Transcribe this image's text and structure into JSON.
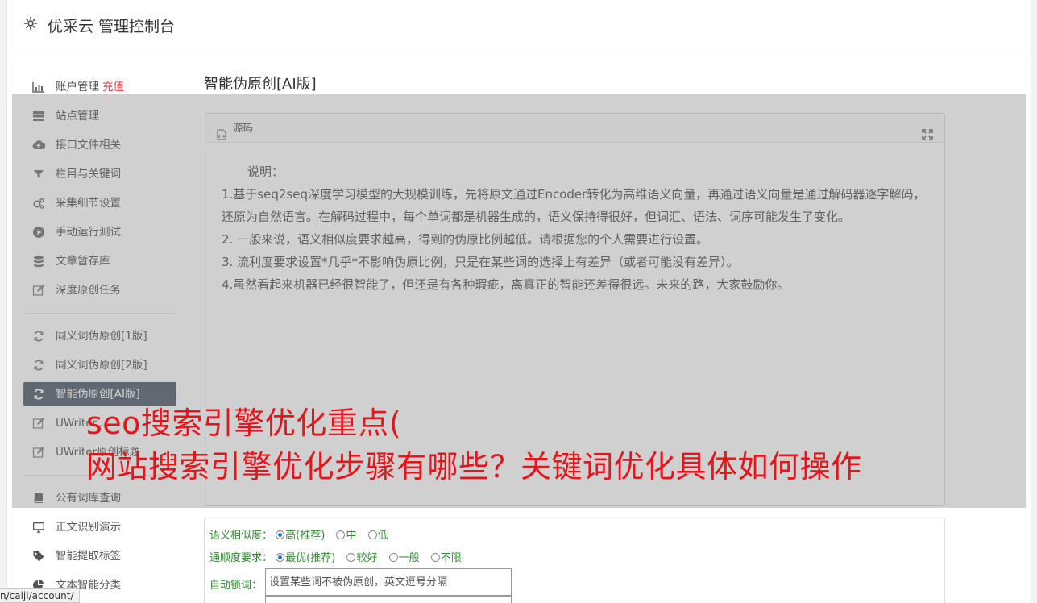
{
  "header": {
    "title": "优采云 管理控制台"
  },
  "sidebar": {
    "group1": [
      {
        "label": "账户管理",
        "extra": "充值",
        "icon": "bar-chart-icon"
      },
      {
        "label": "站点管理",
        "icon": "server-icon"
      },
      {
        "label": "接口文件相关",
        "icon": "cloud-upload-icon"
      },
      {
        "label": "栏目与关键词",
        "icon": "filter-icon"
      },
      {
        "label": "采集细节设置",
        "icon": "gears-icon"
      },
      {
        "label": "手动运行测试",
        "icon": "play-circle-icon"
      },
      {
        "label": "文章暂存库",
        "icon": "database-icon"
      },
      {
        "label": "深度原创任务",
        "icon": "edit-icon"
      }
    ],
    "group2": [
      {
        "label": "同义词伪原创[1版]",
        "icon": "refresh-icon"
      },
      {
        "label": "同义词伪原创[2版]",
        "icon": "refresh-icon"
      },
      {
        "label": "智能伪原创[AI版]",
        "icon": "refresh-icon",
        "active": true
      },
      {
        "label": "UWriter...",
        "icon": "edit-icon"
      },
      {
        "label": "UWriter原创标题",
        "icon": "edit-icon"
      }
    ],
    "group3": [
      {
        "label": "公有词库查询",
        "icon": "book-icon"
      },
      {
        "label": "正文识别演示",
        "icon": "monitor-icon"
      },
      {
        "label": "智能提取标签",
        "icon": "tag-icon"
      },
      {
        "label": "文本智能分类",
        "icon": "pie-chart-icon"
      }
    ]
  },
  "main": {
    "page_title": "智能伪原创[AI版]",
    "panel_title": "源码",
    "description": {
      "heading": "说明：",
      "lines": [
        "1.基于seq2seq深度学习模型的大规模训练，先将原文通过Encoder转化为高维语义向量，再通过语义向量是通过解码器逐字解码，还原为自然语言。在解码过程中，每个单词都是机器生成的，语义保持得很好，但词汇、语法、词序可能发生了变化。",
        "2. 一般来说，语义相似度要求越高，得到的伪原比例越低。请根据您的个人需要进行设置。",
        "3. 流利度要求设置*几乎*不影响伪原比例，只是在某些词的选择上有差异（或者可能没有差异）。",
        "4.虽然看起来机器已经很智能了，但还是有各种瑕疵，离真正的智能还差得很远。未来的路，大家鼓励你。"
      ]
    }
  },
  "form": {
    "similarity": {
      "label": "语义相似度：",
      "options": [
        "高(推荐)",
        "中",
        "低"
      ],
      "selected": 0
    },
    "fluency": {
      "label": "通顺度要求：",
      "options": [
        "最优(推荐)",
        "较好",
        "一般",
        "不限"
      ],
      "selected": 0
    },
    "lock": {
      "label": "自动锁词：",
      "placeholder": "设置某些词不被伪原创，英文逗号分隔"
    }
  },
  "watermark": {
    "line1": "seo搜索引擎优化重点(",
    "line2": "网站搜索引擎优化步骤有哪些？关键词优化具体如何操作"
  },
  "statusbar": {
    "url": "n/caiji/account/"
  }
}
